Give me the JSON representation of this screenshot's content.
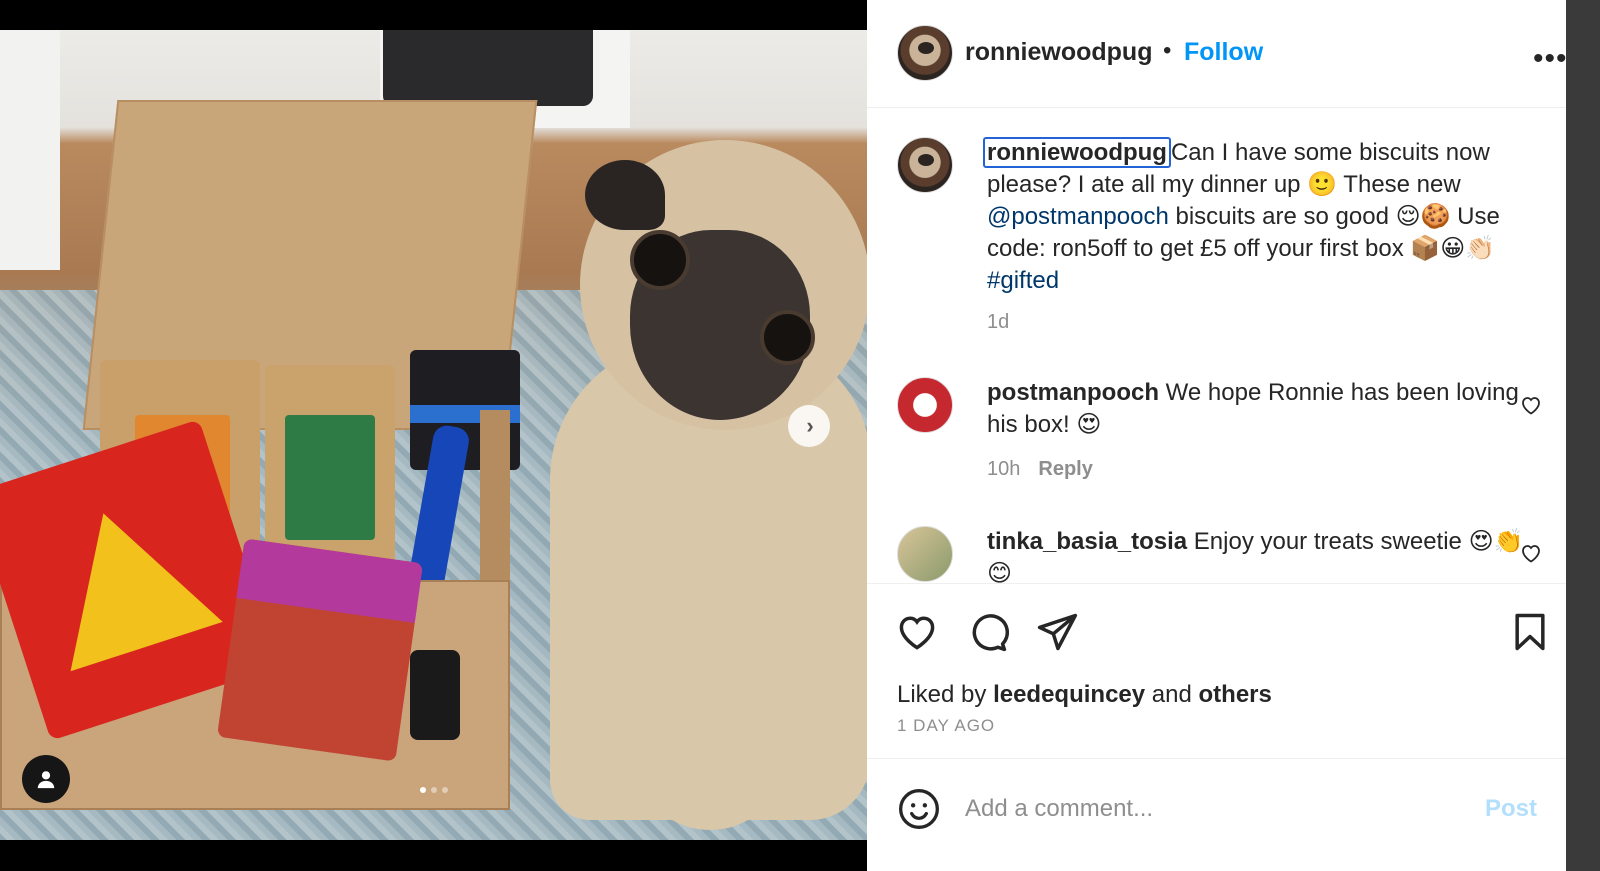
{
  "post": {
    "author": "ronniewoodpug",
    "separator": "•",
    "follow_label": "Follow",
    "more_label": "•••"
  },
  "caption": {
    "username": "ronniewoodpug",
    "text_1": "Can I have some biscuits now please? I ate all my dinner up 🙂 These new ",
    "mention": "@postmanpooch",
    "text_2": " biscuits are so good 😌🍪 Use code: ron5off to get £5 off your first box 📦😀👏🏻",
    "hashtag": "#gifted",
    "time": "1d"
  },
  "comments": [
    {
      "username": "postmanpooch",
      "text": "We hope Ronnie has been loving his box! 😍",
      "time": "10h",
      "reply_label": "Reply"
    },
    {
      "username": "tinka_basia_tosia",
      "text": "Enjoy your treats sweetie 😍👏😊"
    }
  ],
  "likes": {
    "prefix": "Liked by ",
    "user": "leedequincey",
    "middle": " and ",
    "others": "others",
    "date": "1 DAY AGO"
  },
  "composer": {
    "placeholder": "Add a comment...",
    "post_label": "Post"
  },
  "media": {
    "next_label": "›",
    "carousel_count": 3,
    "carousel_active": 1
  },
  "icons": {
    "like": "heart-icon",
    "comment": "comment-bubble-icon",
    "share": "paper-plane-icon",
    "save": "bookmark-icon",
    "emoji": "smiley-icon",
    "tag": "user-tag-icon"
  },
  "colors": {
    "accent": "#0095f6",
    "text": "#262626",
    "muted": "#8e8e8e",
    "post_disabled": "#b2dffc",
    "link": "#00376b"
  }
}
